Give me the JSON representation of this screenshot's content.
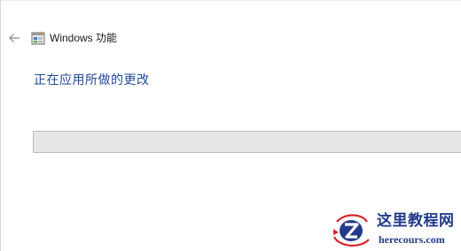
{
  "window": {
    "title": "Windows 功能"
  },
  "icons": {
    "back": "back-arrow-icon",
    "app": "windows-features-icon",
    "watermark_logo": "herecours-logo"
  },
  "main": {
    "heading": "正在应用所做的更改"
  },
  "progress": {
    "value": 0
  },
  "watermark": {
    "name": "这里教程网",
    "url": "herecours.com"
  },
  "colors": {
    "heading": "#1f4b99",
    "progress_track": "#e6e6e6",
    "progress_fill": "#06b025",
    "watermark_text": "#243b8a",
    "watermark_red": "#d8262c"
  }
}
